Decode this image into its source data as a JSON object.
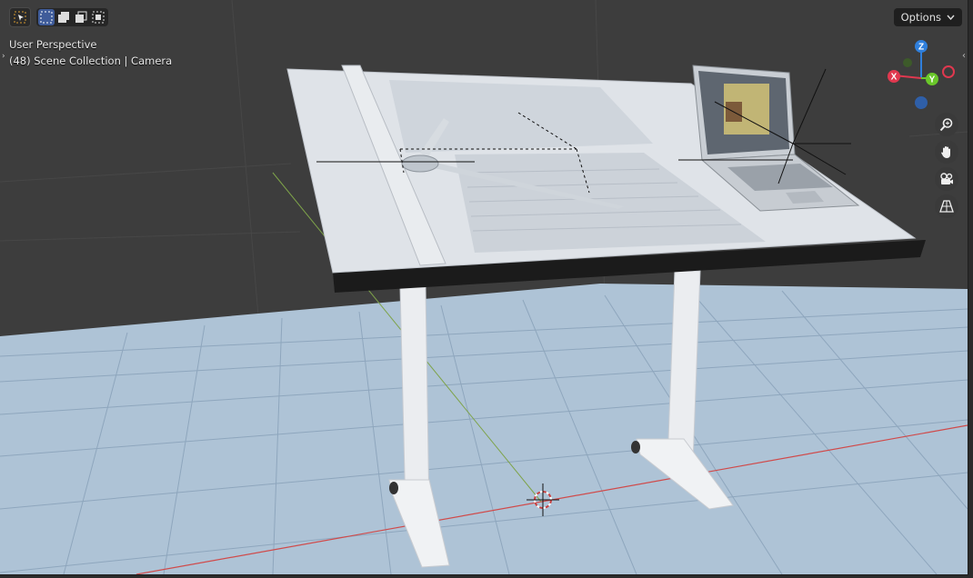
{
  "viewport": {
    "title": "User Perspective",
    "collection": "(48) Scene Collection | Camera",
    "options_label": "Options"
  },
  "toolbar": {
    "tools": [
      "select-box-icon",
      "mode-new-icon",
      "mode-extend-icon",
      "mode-subtract-icon",
      "mode-intersect-icon"
    ]
  },
  "gizmo": {
    "axes": [
      {
        "label": "Z",
        "color": "#2f7fdc"
      },
      {
        "label": "Y",
        "color": "#6ac72a"
      },
      {
        "label": "X",
        "color": "#e0384f"
      }
    ]
  },
  "navigation": [
    "zoom-icon",
    "hand-pan-icon",
    "camera-icon",
    "perspective-grid-icon"
  ],
  "colors": {
    "floor": "#aec3d6",
    "x_axis": "#d04a4a",
    "y_axis": "#7ea34a",
    "accent": "#3f5c9a",
    "desk": "#dfe3e8"
  }
}
